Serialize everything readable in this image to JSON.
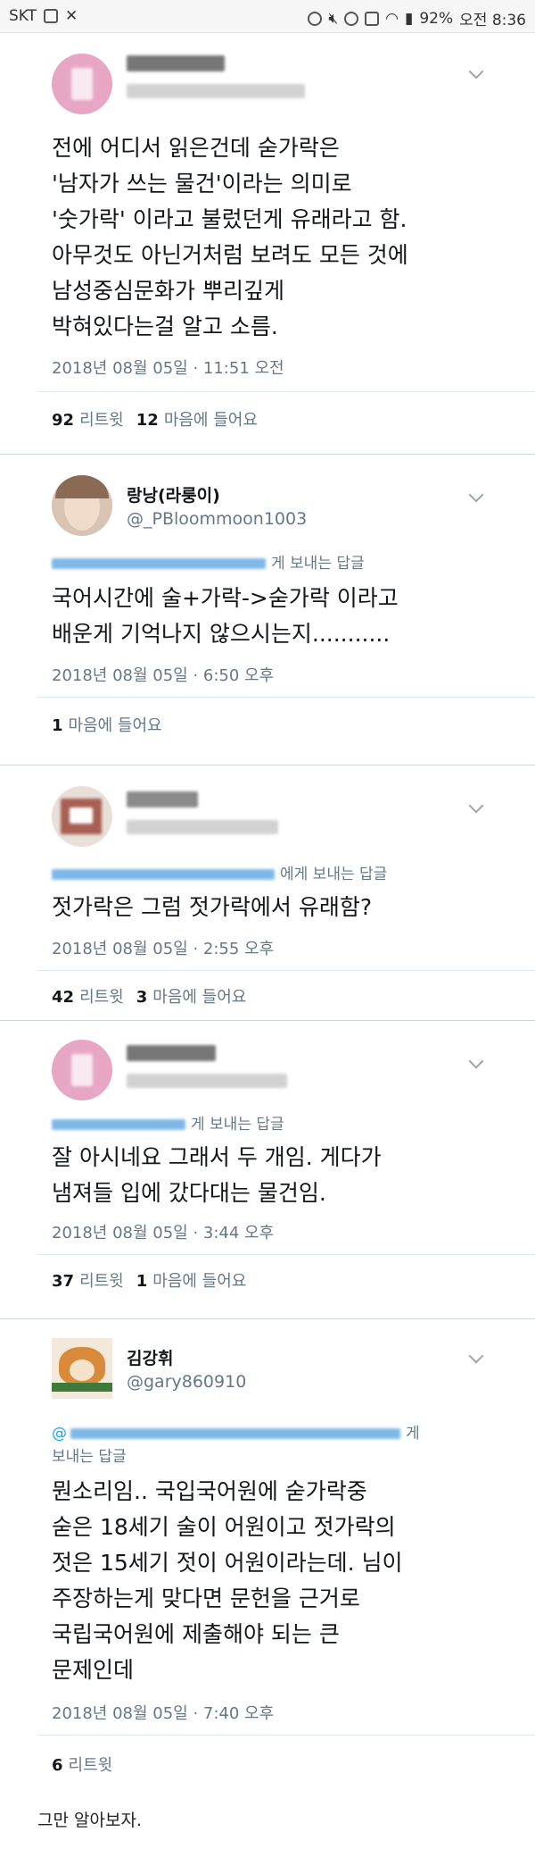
{
  "status_bar": {
    "carrier": "SKT",
    "battery": "92%",
    "time": "오전 8:36"
  },
  "tweets": [
    {
      "body": "전에 어디서 읽은건데 숟가락은\n'남자가 쓰는 물건'이라는 의미로\n'숫가락' 이라고 불렀던게 유래라고 함.\n아무것도 아닌거처럼 보려도 모든 것에\n남성중심문화가 뿌리깊게\n박혀있다는걸 알고 소름.",
      "time": "2018년 08월 05일 · 11:51 오전",
      "retweets": "92",
      "retweet_label": "리트윗",
      "likes": "12",
      "like_label": "마음에 들어요"
    },
    {
      "name": "랑낭(라룽이)",
      "handle": "@_PBloommoon1003",
      "reply_to": "게 보내는 답글",
      "body": "국어시간에 술+가락->숟가락 이라고\n배운게 기억나지 않으시는지...........",
      "time": "2018년 08월 05일 · 6:50 오후",
      "likes": "1",
      "like_label": "마음에 들어요"
    },
    {
      "reply_to": "에게 보내는 답글",
      "body": "젓가락은  그럼  젓가락에서 유래함?",
      "time": "2018년 08월 05일 · 2:55 오후",
      "retweets": "42",
      "retweet_label": "리트윗",
      "likes": "3",
      "like_label": "마음에 들어요"
    },
    {
      "reply_to": "게 보내는 답글",
      "body": "잘 아시네요 그래서 두 개임. 게다가\n냄져들 입에 갔다대는 물건임.",
      "time": "2018년 08월 05일 · 3:44 오후",
      "retweets": "37",
      "retweet_label": "리트윗",
      "likes": "1",
      "like_label": "마음에 들어요"
    },
    {
      "name": "김강휘",
      "handle": "@gary860910",
      "reply_to_line1": "게",
      "reply_to_line2": "보내는 답글",
      "body": "뭔소리임.. 국입국어원에 숟가락중\n숟은 18세기 술이 어원이고 젓가락의\n젓은 15세기 젓이 어원이라는데. 님이\n주장하는게 맞다면 문헌을 근거로\n국립국어원에 제출해야 되는 큰\n문제인데",
      "time": "2018년 08월 05일 · 7:40 오후",
      "retweets": "6",
      "retweet_label": "리트윗"
    }
  ],
  "caption": "그만 알아보자."
}
